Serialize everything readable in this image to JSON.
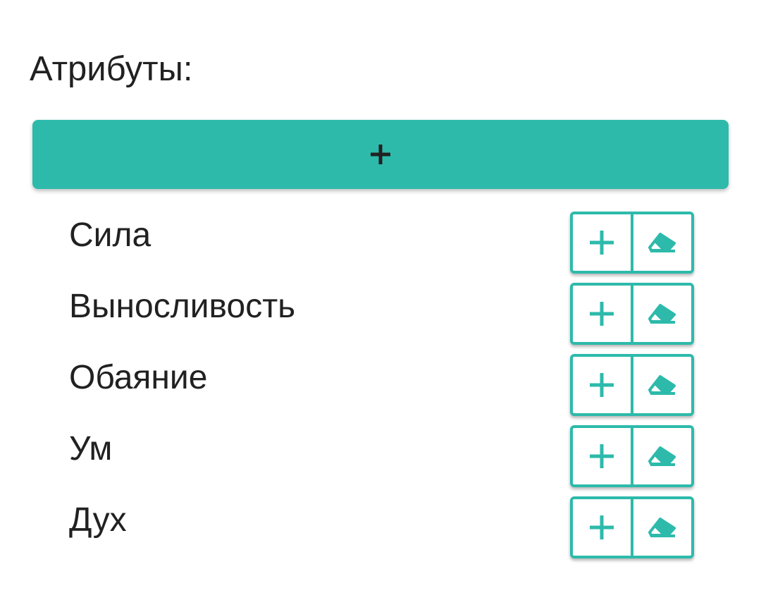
{
  "section": {
    "title": "Атрибуты:"
  },
  "add_button": {
    "icon": "plus-icon"
  },
  "attributes": [
    {
      "label": "Сила"
    },
    {
      "label": "Выносливость"
    },
    {
      "label": "Обаяние"
    },
    {
      "label": "Ум"
    },
    {
      "label": "Дух"
    }
  ],
  "row_buttons": {
    "increase_icon": "plus-icon",
    "clear_icon": "eraser-icon"
  },
  "colors": {
    "accent": "#2dbaab",
    "text": "#212121",
    "background": "#ffffff"
  }
}
